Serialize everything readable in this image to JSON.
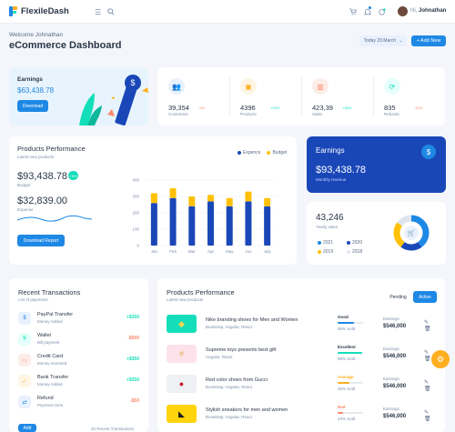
{
  "brand": {
    "name": "FlexileDash"
  },
  "topbar": {
    "menu_icon": "menu-icon",
    "search_icon": "search-icon",
    "cart_icon": "cart-icon",
    "bell_icon": "bell-icon",
    "user_greeting": "Hi,",
    "user_name": "Johnathan"
  },
  "header": {
    "welcome": "Welcome Johnathan",
    "title": "eCommerce Dashboard",
    "date_label": "Today 23 March",
    "new_label": "+ Add New"
  },
  "earnings_card": {
    "title": "Earnings",
    "value": "$63,438.78",
    "button": "Download"
  },
  "stats": [
    {
      "value": "39,354",
      "change": "-9%",
      "label": "Customers",
      "color": "#1e88e5",
      "bg": "#e8f1fd",
      "icon": "users-icon",
      "change_color": "#fa896b"
    },
    {
      "value": "4396",
      "change": "+23%",
      "label": "Products",
      "color": "#ffae1f",
      "bg": "#fef5e5",
      "icon": "box-icon",
      "change_color": "#13deb9"
    },
    {
      "value": "423,39",
      "change": "+38%",
      "label": "Sales",
      "color": "#fa896b",
      "bg": "#fdede8",
      "icon": "bar-chart-icon",
      "change_color": "#13deb9"
    },
    {
      "value": "835",
      "change": "-12%",
      "label": "Refunds",
      "color": "#13deb9",
      "bg": "#e6fffa",
      "icon": "refresh-icon",
      "change_color": "#fa896b"
    }
  ],
  "products_performance": {
    "title": "Products Performance",
    "subtitle": "Latest new products",
    "budget_value": "$93,438.78",
    "budget_badge": "+9%",
    "budget_label": "Budget",
    "expense_value": "$32,839.00",
    "expense_label": "Expense",
    "button": "Download Report",
    "legend": {
      "expense": "Expence",
      "budget": "Budget"
    }
  },
  "chart_data": {
    "type": "bar",
    "stacked": true,
    "categories": [
      "Jan",
      "Feb",
      "Mar",
      "Apr",
      "May",
      "Jun",
      "July"
    ],
    "series": [
      {
        "name": "Expence",
        "values": [
          260,
          290,
          240,
          270,
          240,
          270,
          240
        ],
        "color": "#1a47b8"
      },
      {
        "name": "Budget",
        "values": [
          60,
          60,
          60,
          40,
          50,
          60,
          50
        ],
        "color": "#ffc107"
      }
    ],
    "y_ticks": [
      "400",
      "300",
      "200",
      "100",
      "0"
    ],
    "ylim": [
      0,
      400
    ]
  },
  "earnings_blue": {
    "title": "Earnings",
    "value": "$93,438.78",
    "sub": "Monthly revenue",
    "icon": "dollar-icon"
  },
  "yearly": {
    "value": "43,246",
    "label": "Yearly sales",
    "legend": [
      {
        "year": "2021",
        "color": "#1e88e5"
      },
      {
        "year": "2020",
        "color": "#1a47b8"
      },
      {
        "year": "2019",
        "color": "#ffc107"
      },
      {
        "year": "2018",
        "color": "#dfe5ef"
      }
    ],
    "donut": [
      40,
      20,
      25,
      15
    ]
  },
  "transactions": {
    "title": "Recent Transactions",
    "subtitle": "List of payments",
    "items": [
      {
        "title": "PayPal Transfer",
        "sub": "Money Added",
        "amount": "+$350",
        "amount_color": "#13deb9",
        "icon": "paypal-icon",
        "glyph": "$",
        "color": "#1e88e5",
        "bg": "#e8f1fd"
      },
      {
        "title": "Wallet",
        "sub": "Bill payment",
        "amount": "-$560",
        "amount_color": "#fa896b",
        "icon": "shield-icon",
        "glyph": "⛨",
        "color": "#13deb9",
        "bg": "#e6fffa"
      },
      {
        "title": "Credit Card",
        "sub": "Money reversed",
        "amount": "+$350",
        "amount_color": "#13deb9",
        "icon": "credit-card-icon",
        "glyph": "▭",
        "color": "#fa896b",
        "bg": "#fdede8"
      },
      {
        "title": "Bank Transfer",
        "sub": "Money Added",
        "amount": "+$350",
        "amount_color": "#13deb9",
        "icon": "bank-icon",
        "glyph": "✓",
        "color": "#ffae1f",
        "bg": "#fef5e5"
      },
      {
        "title": "Refund",
        "sub": "Payment Sent",
        "amount": "-$50",
        "amount_color": "#fa896b",
        "icon": "refresh-icon",
        "glyph": "⇄",
        "color": "#1e88e5",
        "bg": "#e8f1fd"
      }
    ],
    "add_button": "Add",
    "footer_link": "20 Recent Transactions"
  },
  "perf2": {
    "title": "Products Performance",
    "subtitle": "Latest new products",
    "tabs": [
      "Pending",
      "Active"
    ],
    "earnings_label": "Earnings",
    "items": [
      {
        "title": "Nike branding shoes for Men and Women",
        "sub": "Bootstrap, Angular, React",
        "status": "Good",
        "status_color": "#2a3547",
        "progress": 0.65,
        "bar_color": "#1e88e5",
        "sold": "65% Sold",
        "earnings": "$546,000",
        "img_bg": "#13deb9",
        "img_icon": "shoe-icon",
        "glyph": "◆",
        "glyph_color": "#ffd34d"
      },
      {
        "title": "Supreme toys presents best gift",
        "sub": "Angular, React",
        "status": "Excellent",
        "status_color": "#2a3547",
        "progress": 0.98,
        "bar_color": "#13deb9",
        "sold": "98% Sold",
        "earnings": "$546,000",
        "img_bg": "#fde2ec",
        "img_icon": "toy-icon",
        "glyph": "#",
        "glyph_color": "#e6b35a"
      },
      {
        "title": "Red color shoes from Gucci",
        "sub": "Bootstrap, Angular, React",
        "status": "Average",
        "status_color": "#ffae1f",
        "progress": 0.46,
        "bar_color": "#ffae1f",
        "sold": "46% Sold",
        "earnings": "$546,000",
        "img_bg": "#eef0f3",
        "img_icon": "red-shoe-icon",
        "glyph": "●",
        "glyph_color": "#c9152d"
      },
      {
        "title": "Stylish sneakers for men and women",
        "sub": "Bootstrap, Angular, React",
        "status": "Bad",
        "status_color": "#fa896b",
        "progress": 0.23,
        "bar_color": "#fa896b",
        "sold": "23% Sold",
        "earnings": "$546,000",
        "img_bg": "#ffd40c",
        "img_icon": "sneaker-icon",
        "glyph": "◣",
        "glyph_color": "#1a1a1a"
      }
    ]
  },
  "fab": {
    "icon": "settings-icon"
  }
}
